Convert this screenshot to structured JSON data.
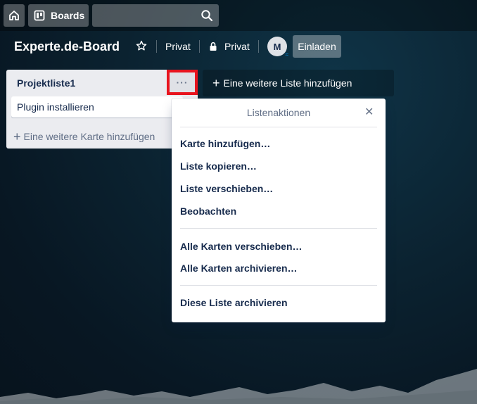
{
  "topbar": {
    "home_icon": "home-icon",
    "boards_label": "Boards",
    "boards_icon": "boards-icon",
    "search_value": "",
    "search_icon": "search-icon"
  },
  "board": {
    "title": "Experte.de-Board",
    "visibility_team_label": "Privat",
    "visibility_label": "Privat",
    "avatar_initial": "M",
    "invite_label": "Einladen"
  },
  "list": {
    "title": "Projektliste1",
    "menu_label": "···",
    "cards": [
      {
        "title": "Plugin installieren"
      }
    ],
    "add_card_label": "Eine weitere Karte hinzufügen"
  },
  "add_list_label": "Eine weitere Liste hinzufügen",
  "popover": {
    "title": "Listenaktionen",
    "close_label": "✕",
    "groups": [
      [
        "Karte hinzufügen…",
        "Liste kopieren…",
        "Liste verschieben…",
        "Beobachten"
      ],
      [
        "Alle Karten verschieben…",
        "Alle Karten archivieren…"
      ],
      [
        "Diese Liste archivieren"
      ]
    ]
  },
  "colors": {
    "highlight": "#e8141e",
    "list_bg": "#ebecf0",
    "text": "#172b4d"
  }
}
